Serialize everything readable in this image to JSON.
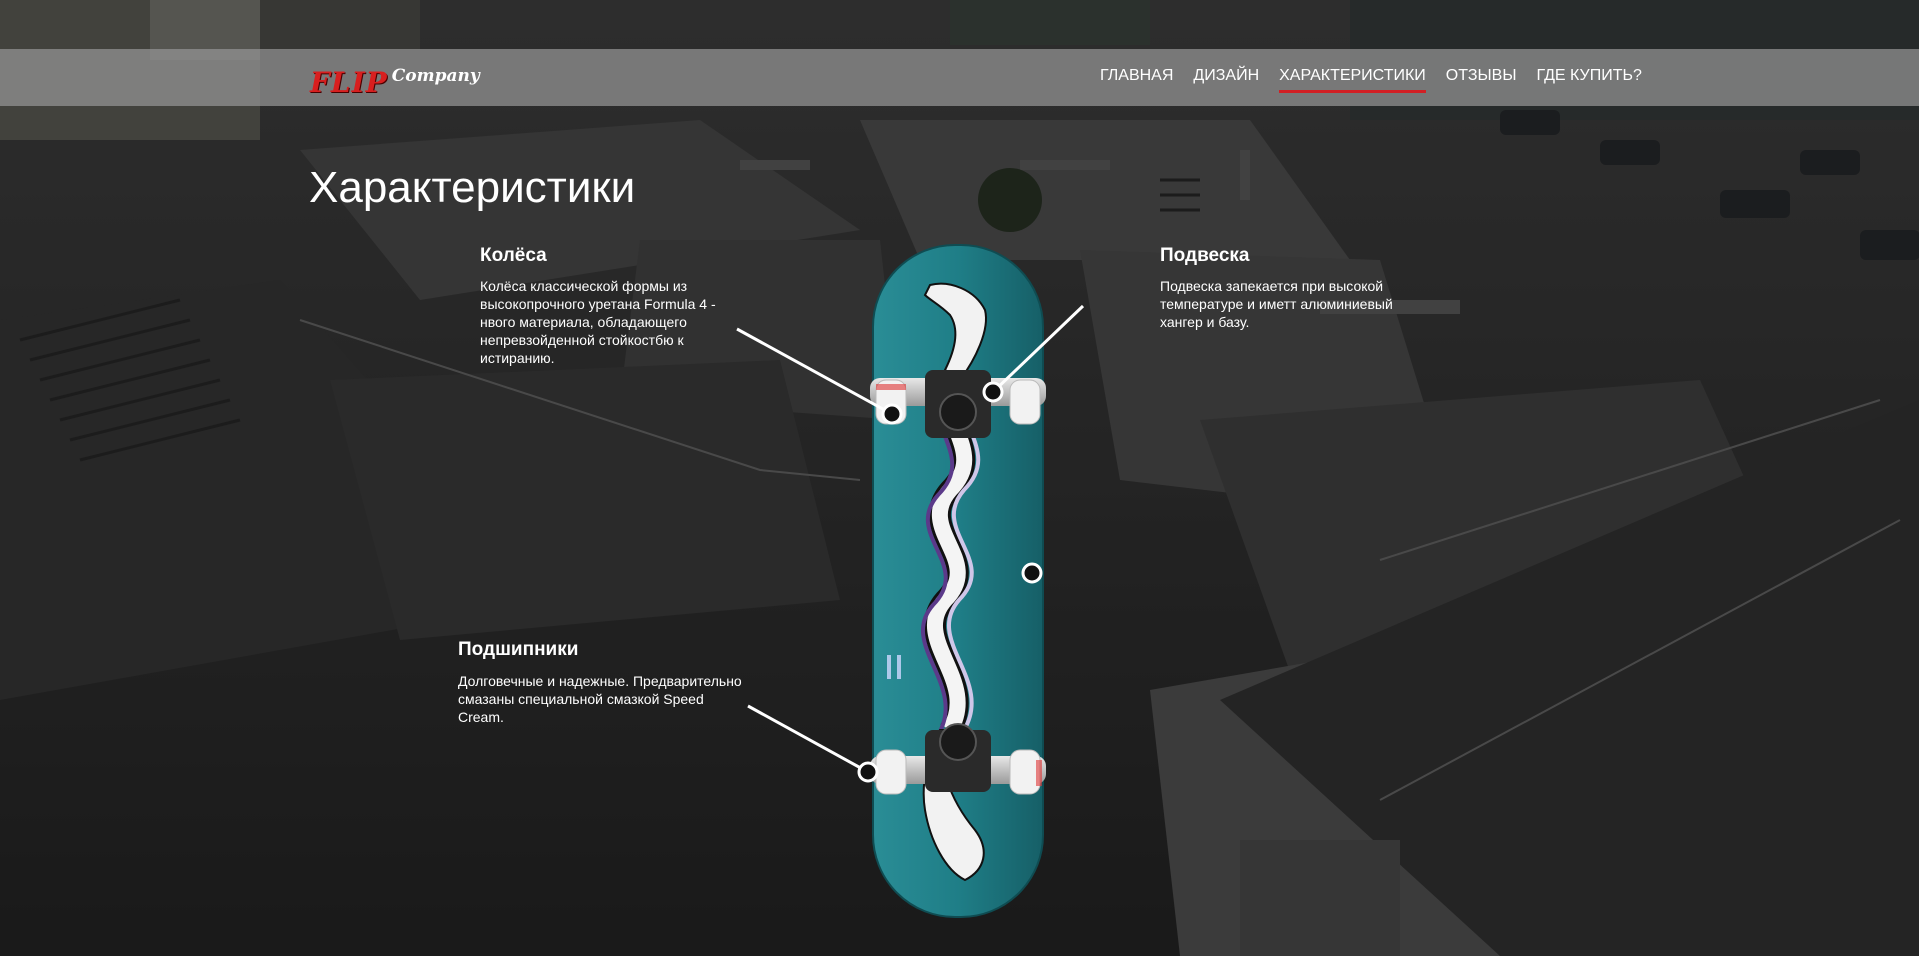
{
  "header": {
    "logo": {
      "flip": "FLIP",
      "company": "Company"
    },
    "nav": [
      {
        "label": "ГЛАВНАЯ",
        "active": false
      },
      {
        "label": "ДИЗАЙН",
        "active": false
      },
      {
        "label": "ХАРАКТЕРИСТИКИ",
        "active": true
      },
      {
        "label": "ОТЗЫВЫ",
        "active": false
      },
      {
        "label": "ГДЕ КУПИТЬ?",
        "active": false
      }
    ]
  },
  "main": {
    "title": "Характеристики",
    "features": {
      "wheels": {
        "title": "Колёса",
        "text": "Колёса классической формы из высокопрочного уретана Formula 4 - нвого материала, обладающего непревзойденной стойкостбю к истиранию."
      },
      "suspension": {
        "title": "Подвеска",
        "text": "Подвеска запекается при высокой температуре и иметт алюминиевый хангер и базу."
      },
      "bearings": {
        "title": "Подшипники",
        "text": "Долговечные и надежные. Предварительно смазаны специальной смазкой Speed Cream."
      }
    }
  },
  "colors": {
    "accent": "#d21f24",
    "deck": "#1e7d86",
    "header_bg": "#969696"
  },
  "icons": {
    "hotspot": "hotspot-dot-icon"
  }
}
